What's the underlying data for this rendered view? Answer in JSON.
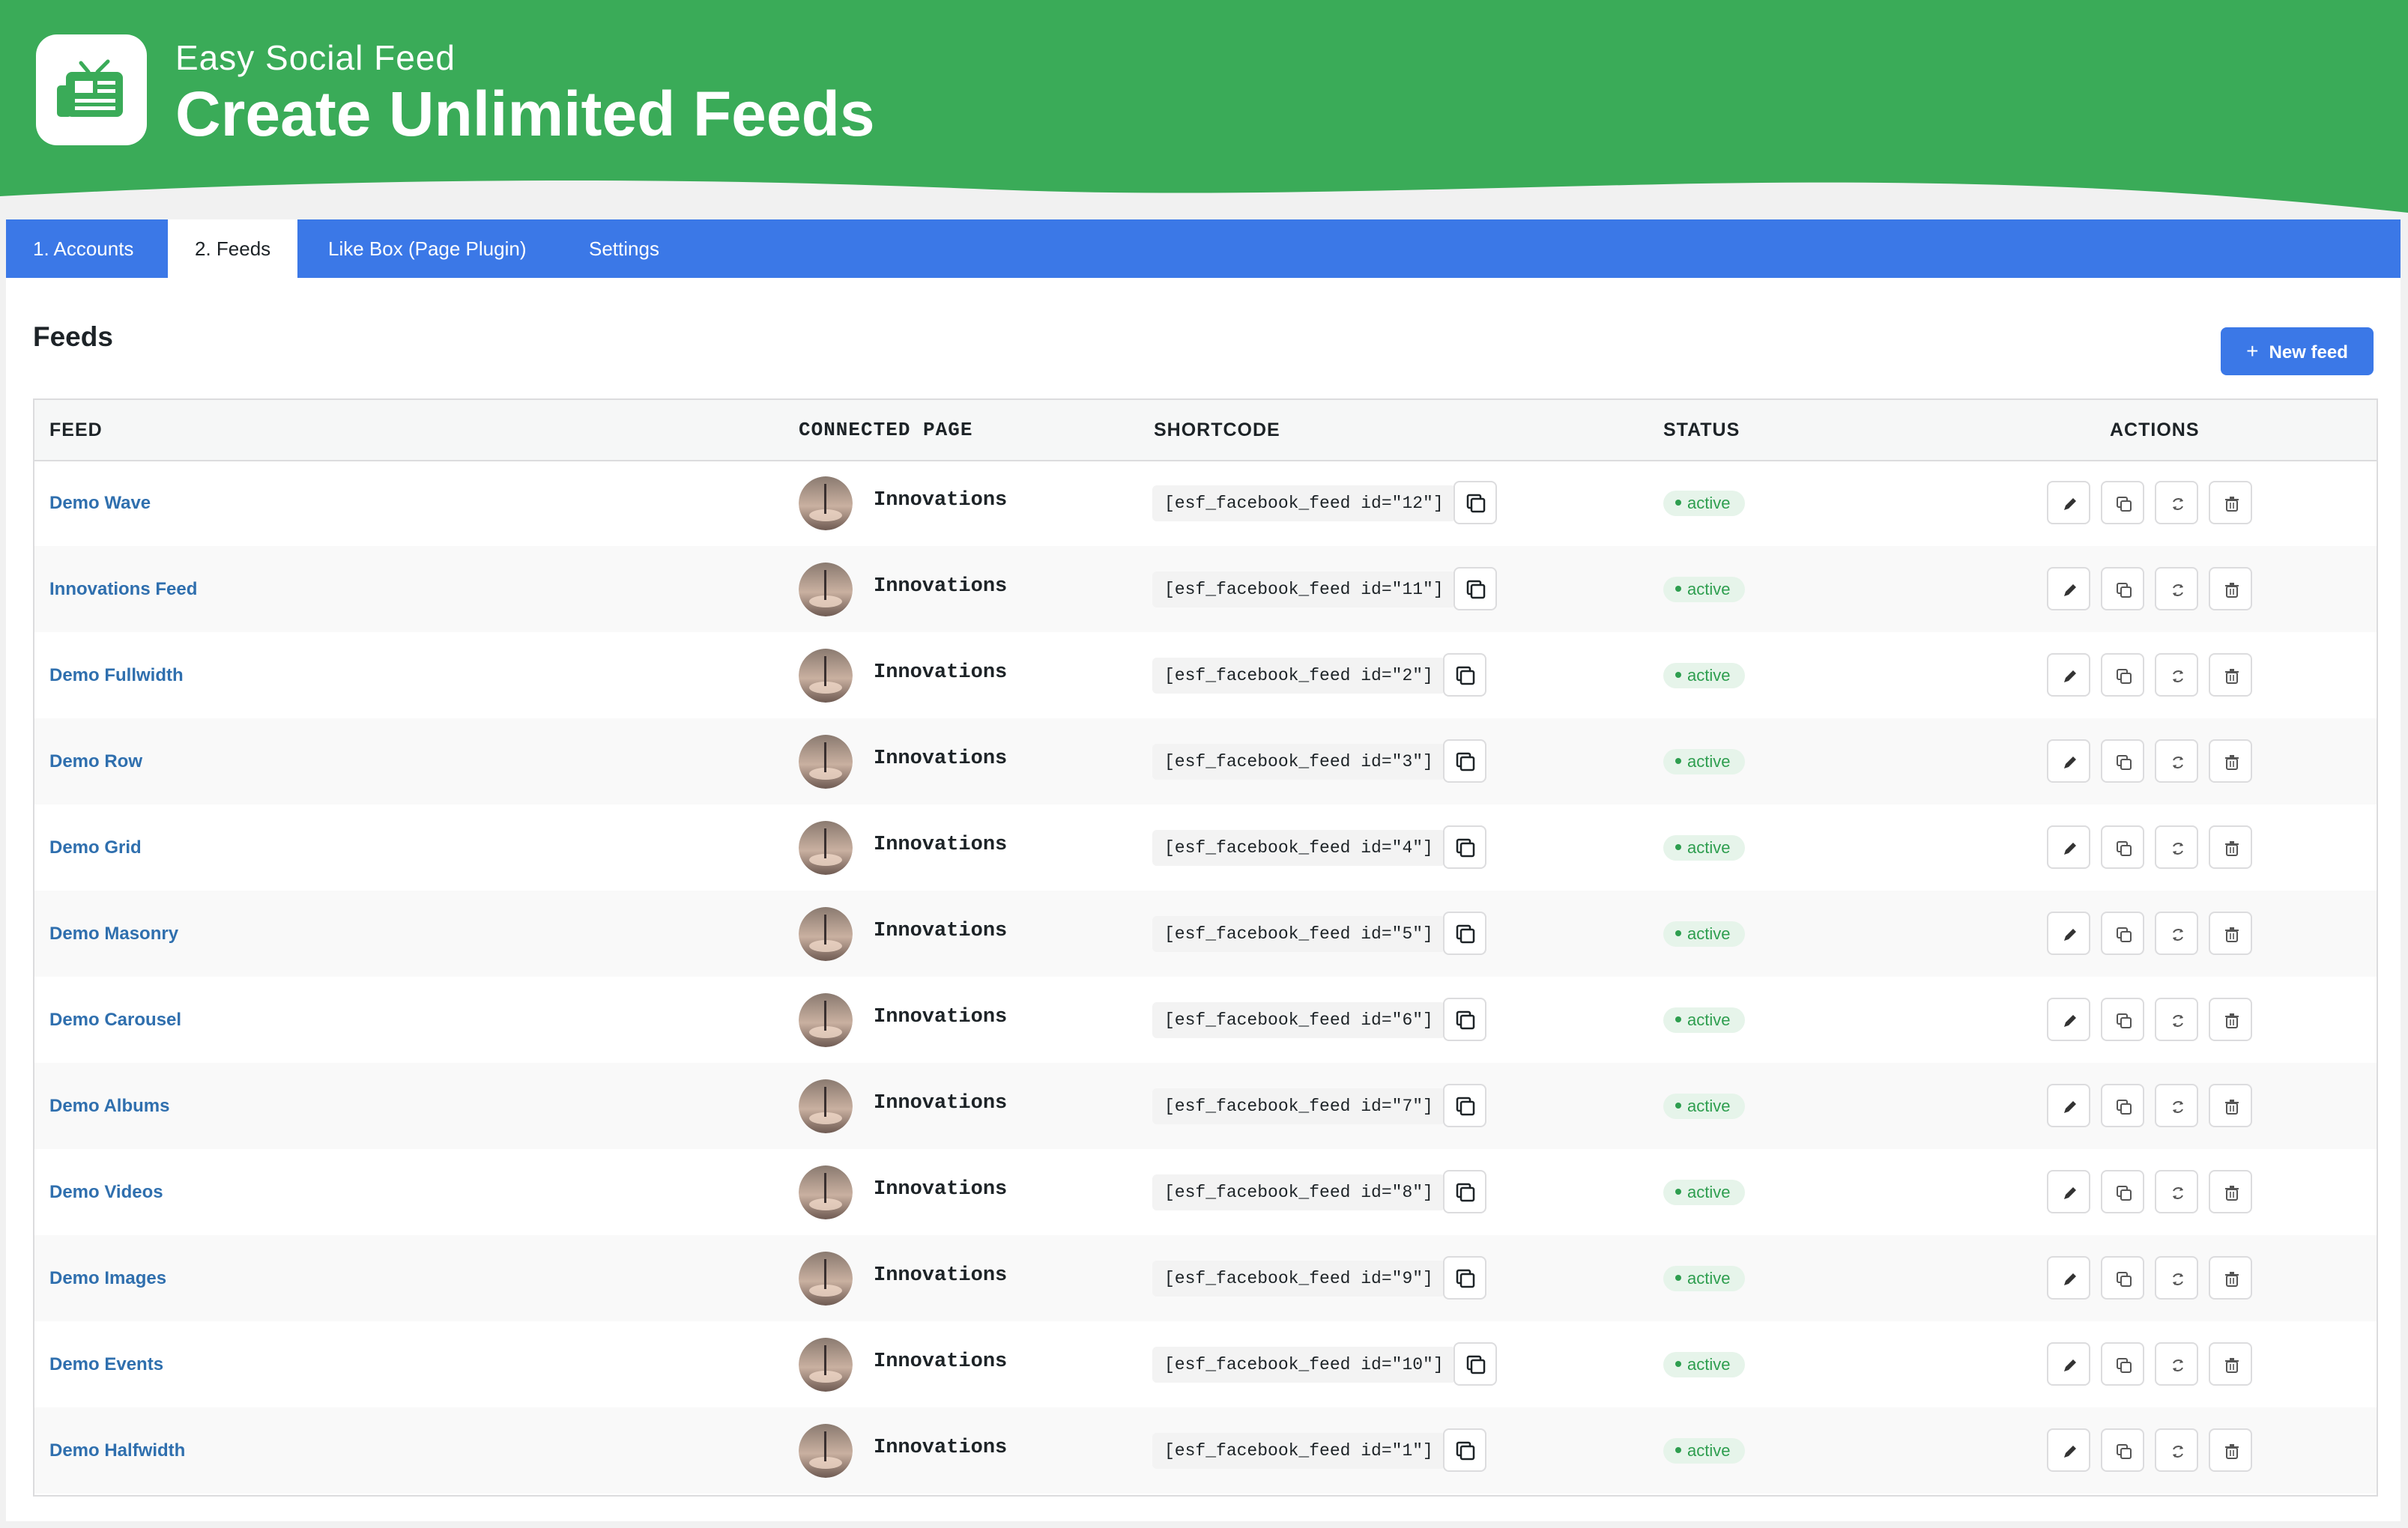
{
  "header": {
    "brand": "Easy Social Feed",
    "headline": "Create Unlimited Feeds",
    "logo_icon": "tv-news-icon",
    "color": "#3aab58"
  },
  "tabs": [
    {
      "label": "1. Accounts",
      "active": false
    },
    {
      "label": "2. Feeds",
      "active": true
    },
    {
      "label": "Like Box (Page Plugin)",
      "active": false
    },
    {
      "label": "Settings",
      "active": false
    }
  ],
  "main": {
    "title": "Feeds",
    "new_button_label": "New feed",
    "new_button_icon": "plus-icon"
  },
  "table": {
    "columns": {
      "feed": "FEED",
      "page": "CONNECTED PAGE",
      "shortcode": "SHORTCODE",
      "status": "STATUS",
      "actions": "ACTIONS"
    },
    "action_icons": [
      "edit-icon",
      "duplicate-icon",
      "refresh-icon",
      "delete-icon"
    ],
    "rows": [
      {
        "name": "Demo Wave",
        "page": "Innovations",
        "shortcode": "[esf_facebook_feed id=\"12\"]",
        "status": "active"
      },
      {
        "name": "Innovations Feed",
        "page": "Innovations",
        "shortcode": "[esf_facebook_feed id=\"11\"]",
        "status": "active"
      },
      {
        "name": "Demo Fullwidth",
        "page": "Innovations",
        "shortcode": "[esf_facebook_feed id=\"2\"]",
        "status": "active"
      },
      {
        "name": "Demo Row",
        "page": "Innovations",
        "shortcode": "[esf_facebook_feed id=\"3\"]",
        "status": "active"
      },
      {
        "name": "Demo Grid",
        "page": "Innovations",
        "shortcode": "[esf_facebook_feed id=\"4\"]",
        "status": "active"
      },
      {
        "name": "Demo Masonry",
        "page": "Innovations",
        "shortcode": "[esf_facebook_feed id=\"5\"]",
        "status": "active"
      },
      {
        "name": "Demo Carousel",
        "page": "Innovations",
        "shortcode": "[esf_facebook_feed id=\"6\"]",
        "status": "active"
      },
      {
        "name": "Demo Albums",
        "page": "Innovations",
        "shortcode": "[esf_facebook_feed id=\"7\"]",
        "status": "active"
      },
      {
        "name": "Demo Videos",
        "page": "Innovations",
        "shortcode": "[esf_facebook_feed id=\"8\"]",
        "status": "active"
      },
      {
        "name": "Demo Images",
        "page": "Innovations",
        "shortcode": "[esf_facebook_feed id=\"9\"]",
        "status": "active"
      },
      {
        "name": "Demo Events",
        "page": "Innovations",
        "shortcode": "[esf_facebook_feed id=\"10\"]",
        "status": "active"
      },
      {
        "name": "Demo Halfwidth",
        "page": "Innovations",
        "shortcode": "[esf_facebook_feed id=\"1\"]",
        "status": "active"
      }
    ]
  }
}
